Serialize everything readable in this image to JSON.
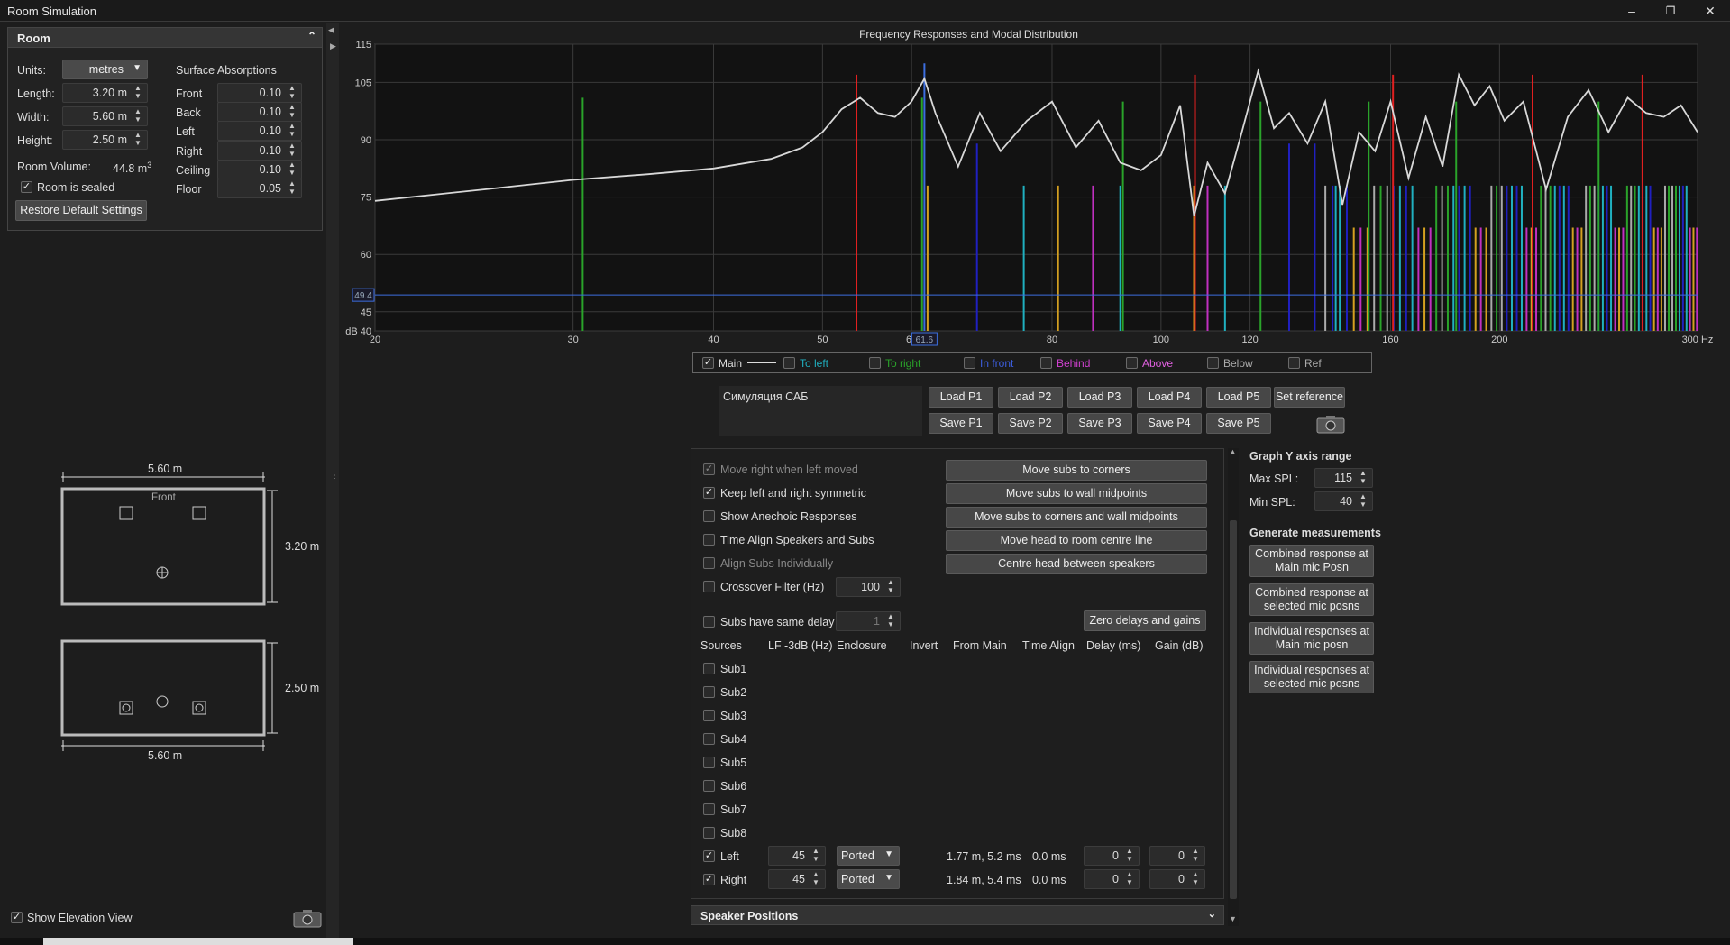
{
  "window": {
    "title": "Room Simulation"
  },
  "room": {
    "title": "Room",
    "units_label": "Units:",
    "units_value": "metres",
    "length_label": "Length:",
    "length_value": "3.20 m",
    "width_label": "Width:",
    "width_value": "5.60 m",
    "height_label": "Height:",
    "height_value": "2.50 m",
    "volume_label": "Room Volume:",
    "volume_value": "44.8 m",
    "volume_sup": "3",
    "sealed_label": "Room is sealed",
    "sealed_checked": true,
    "restore_label": "Restore Default Settings",
    "surface_title": "Surface Absorptions",
    "surfaces": [
      {
        "label": "Front",
        "value": "0.10"
      },
      {
        "label": "Back",
        "value": "0.10"
      },
      {
        "label": "Left",
        "value": "0.10"
      },
      {
        "label": "Right",
        "value": "0.10"
      },
      {
        "label": "Ceiling",
        "value": "0.10"
      },
      {
        "label": "Floor",
        "value": "0.05"
      }
    ]
  },
  "plan": {
    "top_width": "5.60 m",
    "front_label": "Front",
    "side_length": "3.20 m",
    "elev_height": "2.50 m",
    "elev_width": "5.60 m"
  },
  "show_elevation": {
    "label": "Show Elevation View",
    "checked": true
  },
  "chart_data": {
    "type": "line",
    "title": "Frequency Responses and Modal Distribution",
    "x_scale": "log",
    "xlim": [
      20,
      300
    ],
    "ylim": [
      40,
      115
    ],
    "x_ticks": [
      "20",
      "30",
      "40",
      "50",
      "60",
      "80",
      "100",
      "120",
      "160",
      "200",
      "300 Hz"
    ],
    "x_tick_values": [
      20,
      30,
      40,
      50,
      60,
      80,
      100,
      120,
      160,
      200,
      300
    ],
    "y_ticks": [
      "115",
      "105",
      "90",
      "75",
      "60",
      "45",
      "dB 40"
    ],
    "y_tick_values": [
      115,
      105,
      90,
      75,
      60,
      45,
      40
    ],
    "cursor_y_label": "49.4",
    "cursor_y": 49.4,
    "cursor_x_label": "61.6",
    "cursor_x": 61.6,
    "grid": true,
    "series": [
      {
        "name": "Main",
        "color": "#d8d8d8",
        "x": [
          20,
          25,
          30,
          35,
          40,
          45,
          48,
          50,
          52,
          54,
          56,
          58,
          60,
          61.6,
          63,
          66,
          69,
          72,
          76,
          80,
          84,
          88,
          92,
          96,
          100,
          104,
          107,
          110,
          114,
          118,
          122,
          126,
          130,
          135,
          140,
          145,
          150,
          155,
          160,
          166,
          172,
          178,
          184,
          190,
          196,
          202,
          210,
          220,
          230,
          240,
          250,
          260,
          270,
          280,
          290,
          300
        ],
        "y": [
          74,
          77,
          79.5,
          81,
          82.5,
          85,
          88,
          92,
          98,
          101,
          97,
          96,
          100,
          106,
          97,
          83,
          97,
          87,
          95,
          100,
          88,
          95,
          84,
          82,
          86,
          99,
          70,
          84,
          76,
          92,
          108,
          93,
          97,
          89,
          100,
          73,
          92,
          87,
          100,
          80,
          96,
          83,
          107,
          99,
          104,
          95,
          100,
          77,
          96,
          103,
          92,
          101,
          97,
          96,
          99,
          92
        ]
      }
    ],
    "modes": [
      {
        "f": 30.6,
        "level": 101,
        "color": "#2aa32a"
      },
      {
        "f": 53.6,
        "level": 107,
        "color": "#e02020"
      },
      {
        "f": 61.3,
        "level": 101,
        "color": "#2aa32a"
      },
      {
        "f": 61.6,
        "level": 110,
        "color": "#3c6ee0"
      },
      {
        "f": 62.0,
        "level": 78,
        "color": "#d4a020"
      },
      {
        "f": 68.6,
        "level": 89,
        "color": "#2020c0"
      },
      {
        "f": 75.5,
        "level": 78,
        "color": "#20b0c0"
      },
      {
        "f": 81.0,
        "level": 78,
        "color": "#d4a020"
      },
      {
        "f": 87.0,
        "level": 78,
        "color": "#c030c0"
      },
      {
        "f": 92.0,
        "level": 78,
        "color": "#20b0c0"
      },
      {
        "f": 92.5,
        "level": 100,
        "color": "#2aa32a"
      },
      {
        "f": 107,
        "level": 78,
        "color": "#d4a020"
      },
      {
        "f": 107.2,
        "level": 107,
        "color": "#e02020"
      },
      {
        "f": 110,
        "level": 78,
        "color": "#c030c0"
      },
      {
        "f": 114,
        "level": 78,
        "color": "#20b0c0"
      },
      {
        "f": 122.6,
        "level": 100,
        "color": "#2aa32a"
      },
      {
        "f": 130,
        "level": 89,
        "color": "#2020c0"
      },
      {
        "f": 137,
        "level": 89,
        "color": "#2020c0"
      },
      {
        "f": 143,
        "level": 78,
        "color": "#20b0c0"
      },
      {
        "f": 153,
        "level": 100,
        "color": "#2aa32a"
      },
      {
        "f": 160.8,
        "level": 107,
        "color": "#e02020"
      },
      {
        "f": 183,
        "level": 100,
        "color": "#2aa32a"
      },
      {
        "f": 214,
        "level": 107,
        "color": "#e02020"
      },
      {
        "f": 245,
        "level": 100,
        "color": "#2aa32a"
      },
      {
        "f": 268,
        "level": 107,
        "color": "#e02020"
      }
    ]
  },
  "legend": {
    "items": [
      {
        "label": "Main",
        "checked": true,
        "color": "#dddddd"
      },
      {
        "label": "To left",
        "checked": false,
        "color": "#20b0c0"
      },
      {
        "label": "To right",
        "checked": false,
        "color": "#2aa32a"
      },
      {
        "label": "In front",
        "checked": false,
        "color": "#3c5ee0"
      },
      {
        "label": "Behind",
        "checked": false,
        "color": "#d040d0"
      },
      {
        "label": "Above",
        "checked": false,
        "color": "#e060e0"
      },
      {
        "label": "Below",
        "checked": false,
        "color": "#aaaaaa"
      },
      {
        "label": "Ref",
        "checked": false,
        "color": "#aaaaaa"
      }
    ]
  },
  "notes": {
    "text": "Симуляция САБ"
  },
  "presets": {
    "load": [
      "Load P1",
      "Load P2",
      "Load P3",
      "Load P4",
      "Load P5"
    ],
    "save": [
      "Save P1",
      "Save P2",
      "Save P3",
      "Save P4",
      "Save P5"
    ],
    "set_reference": "Set reference"
  },
  "options": [
    {
      "label": "Move right when left moved",
      "checked": true,
      "disabled": true
    },
    {
      "label": "Keep left and right symmetric",
      "checked": true,
      "disabled": false
    },
    {
      "label": "Show Anechoic Responses",
      "checked": false,
      "disabled": false
    },
    {
      "label": "Time Align Speakers and Subs",
      "checked": false,
      "disabled": false
    },
    {
      "label": "Align Subs Individually",
      "checked": false,
      "disabled": true
    },
    {
      "label": "Crossover Filter (Hz)",
      "checked": false,
      "disabled": false
    }
  ],
  "crossover_value": "100",
  "subs_same_delay": {
    "label": "Subs have same delay",
    "value": "1"
  },
  "move_buttons": [
    "Move subs to corners",
    "Move subs to wall midpoints",
    "Move subs to corners and wall midpoints",
    "Move head to room centre line",
    "Centre head between speakers"
  ],
  "zero_button": "Zero delays and gains",
  "columns": [
    "Sources",
    "LF -3dB (Hz)",
    "Enclosure",
    "Invert",
    "From Main",
    "Time Align",
    "Delay (ms)",
    "Gain (dB)"
  ],
  "subs": [
    "Sub1",
    "Sub2",
    "Sub3",
    "Sub4",
    "Sub5",
    "Sub6",
    "Sub7",
    "Sub8"
  ],
  "speakers": [
    {
      "name": "Left",
      "checked": true,
      "lf": "45",
      "enclosure": "Ported",
      "from_main": "1.77 m, 5.2 ms",
      "time_align": "0.0 ms",
      "delay": "0",
      "gain": "0"
    },
    {
      "name": "Right",
      "checked": true,
      "lf": "45",
      "enclosure": "Ported",
      "from_main": "1.84 m, 5.4 ms",
      "time_align": "0.0 ms",
      "delay": "0",
      "gain": "0"
    }
  ],
  "speaker_positions": {
    "label": "Speaker Positions"
  },
  "y_axis_range": {
    "title": "Graph Y axis range",
    "max_label": "Max SPL:",
    "max_value": "115",
    "min_label": "Min SPL:",
    "min_value": "40"
  },
  "generate": {
    "title": "Generate measurements",
    "buttons": [
      [
        "Combined response at",
        "Main mic Posn"
      ],
      [
        "Combined response at",
        "selected mic posns"
      ],
      [
        "Individual responses at",
        "Main mic posn"
      ],
      [
        "Individual responses at",
        "selected mic posns"
      ]
    ]
  }
}
